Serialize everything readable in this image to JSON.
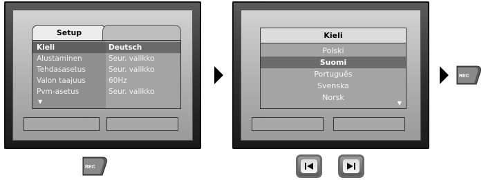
{
  "setup_screen": {
    "tab_label": "Setup",
    "rows": [
      {
        "key": "Kieli",
        "value": "Deutsch",
        "selected": true
      },
      {
        "key": "Alustaminen",
        "value": "Seur. valikko",
        "selected": false
      },
      {
        "key": "Tehdasasetus",
        "value": "Seur. valikko",
        "selected": false
      },
      {
        "key": "Valon taajuus",
        "value": "60Hz",
        "selected": false
      },
      {
        "key": "Pvm-asetus",
        "value": "Seur. valikko",
        "selected": false
      }
    ],
    "more_indicator": "▼"
  },
  "language_screen": {
    "title": "Kieli",
    "items": [
      "Polski",
      "Suomi",
      "Português",
      "Svenska",
      "Norsk"
    ],
    "selected_index": 1,
    "more_indicator": "▼"
  },
  "buttons": {
    "rec_label": "REC"
  },
  "icons": {
    "arrow": "play-arrow-icon",
    "prev": "skip-previous-icon",
    "next": "skip-next-icon"
  }
}
